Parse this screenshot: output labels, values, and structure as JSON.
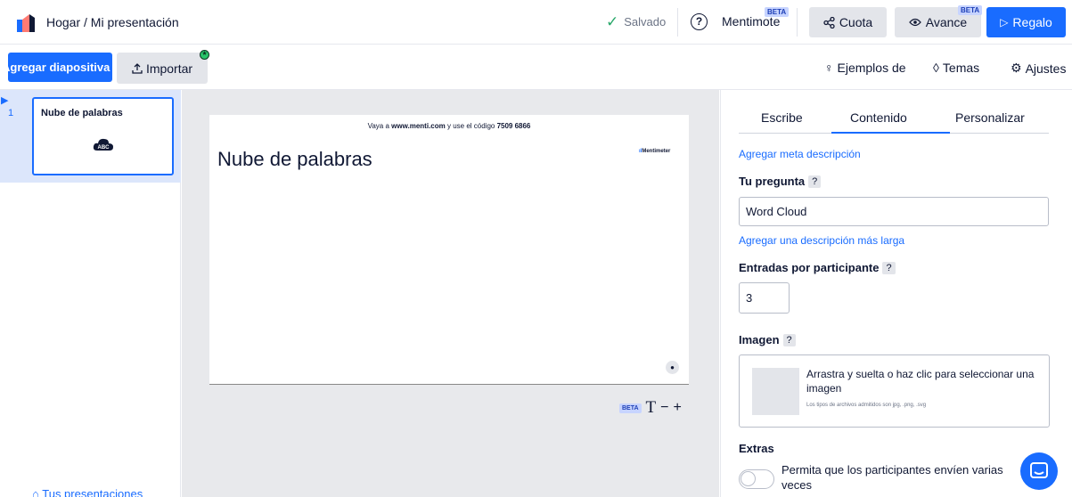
{
  "header": {
    "breadcrumb": "Hogar / Mi presentación",
    "saved_label": "Salvado",
    "help_label": "?",
    "mentimote_label": "Mentimote",
    "mentimote_badge": "BETA",
    "share_label": "Cuota",
    "preview_label": "Avance",
    "preview_badge": "BETA",
    "present_label": "Regalo"
  },
  "toolbar": {
    "add_slide_label": "Agregar diapositiva",
    "import_label": "Importar",
    "examples_label": "Ejemplos de",
    "themes_label": "Temas",
    "settings_label": "Ajustes"
  },
  "slides_panel": {
    "slides": [
      {
        "number": "1",
        "title": "Nube de palabras",
        "icon_text": "ABC"
      }
    ],
    "your_presentations_label": "Tus presentaciones"
  },
  "canvas": {
    "join_prefix": "Vaya a ",
    "join_url": "www.menti.com",
    "join_middle": " y use el código ",
    "join_code": "7509 6866",
    "title": "Nube de palabras",
    "brand": "Mentimeter",
    "tools_badge": "BETA",
    "tools_text": "T",
    "zoom_out": "−",
    "zoom_in": "+"
  },
  "right_panel": {
    "tabs": [
      "Escribe",
      "Contenido",
      "Personalizar"
    ],
    "active_tab": "Contenido",
    "meta_link": "Agregar meta descripción",
    "question_label": "Tu pregunta",
    "question_value": "Word Cloud",
    "long_desc_link": "Agregar una descripción más larga",
    "entries_label": "Entradas por participante",
    "entries_value": "3",
    "image_label": "Imagen",
    "dropzone_text": "Arrastra y suelta o haz clic para seleccionar una imagen",
    "dropzone_hint": "Los tipos de archivos admitidos son jpg, .png, .svg",
    "extras_label": "Extras",
    "toggle_label": "Permita que los participantes envíen varias veces",
    "help_badge": "?"
  },
  "colors": {
    "accent": "#196cff",
    "saved_check": "#29a86a",
    "selected_slide_bg": "#dce6fb"
  }
}
